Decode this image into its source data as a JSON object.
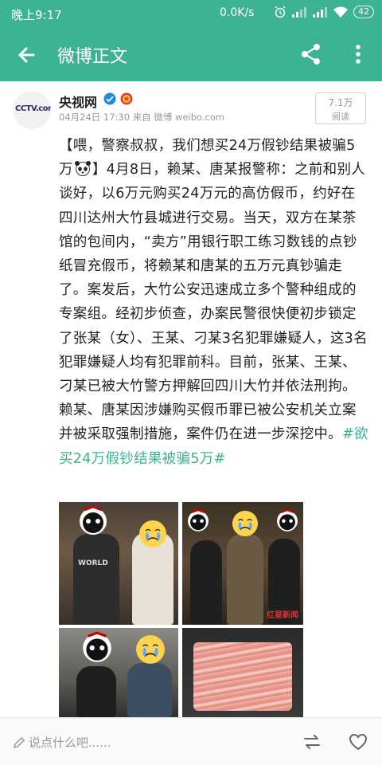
{
  "status_bar": {
    "time": "晚上9:17",
    "network_speed": "0.0K/s",
    "battery": "42",
    "icons": [
      "alarm-icon",
      "signal-icon",
      "signal-icon",
      "wifi-icon",
      "battery-icon"
    ]
  },
  "app_bar": {
    "title": "微博正文",
    "background_color": "#3bb394",
    "icons": [
      "back-arrow-icon",
      "share-icon",
      "more-vertical-icon"
    ]
  },
  "post": {
    "author": {
      "name": "央视网",
      "avatar_text": "CCTV.com",
      "verified_color": "#1e88e5",
      "badges": [
        "verified-icon",
        "medal-icon"
      ]
    },
    "date": "04月24日 17:30",
    "source_prefix": "来自",
    "source": "微博 weibo.com",
    "views": {
      "count": "7.1万",
      "label": "阅读"
    },
    "text": {
      "part1": "【喂，警察叔叔，我们想买24万假钞结果被骗5万",
      "part2": "】4月8日，赖某、唐某报警称：之前和别人谈好，以6万元购买24万元的高仿假币，约好在四川达州大竹县城进行交易。当天，双方在某茶馆的包间内，“卖方”用银行职工练习数钱的点钞纸冒充假币，将赖某和唐某的五万元真钞骗走了。案发后，大竹公安迅速成立多个警种组成的专案组。经初步侦查，办案民警很快便初步锁定了张某（女）、王某、刁某3名犯罪嫌疑人，这3名犯罪嫌疑人均有犯罪前科。目前，张某、王某、刁某已被大竹警方押解回四川大竹并依法刑拘。赖某、唐某因涉嫌购买假币罪已被公安机关立案并被采取强制措施，案件仍在进一步深挖中。",
      "hashtag": "#欲买24万假钞结果被骗5万#",
      "hashtag_color": "#3bb394"
    },
    "images": [
      {
        "name": "suspect-arrest-photo-1",
        "caption": "WORLD"
      },
      {
        "name": "suspect-arrest-photo-2",
        "caption": "红星新闻"
      },
      {
        "name": "suspect-arrest-photo-3",
        "caption": ""
      },
      {
        "name": "counterfeit-money-suitcase-photo",
        "caption": ""
      }
    ]
  },
  "bottom_bar": {
    "comment_placeholder": "说点什么吧......",
    "icons": [
      "edit-icon",
      "repost-icon",
      "like-heart-icon"
    ]
  }
}
